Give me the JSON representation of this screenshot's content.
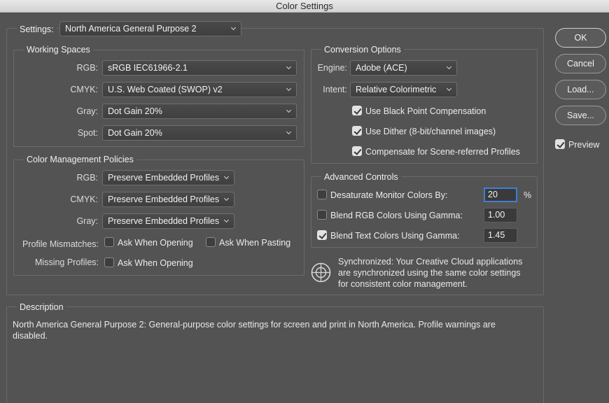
{
  "window": {
    "title": "Color Settings"
  },
  "settings": {
    "label": "Settings:",
    "value": "North America General Purpose 2"
  },
  "working_spaces": {
    "title": "Working Spaces",
    "rgb_label": "RGB:",
    "rgb_value": "sRGB IEC61966-2.1",
    "cmyk_label": "CMYK:",
    "cmyk_value": "U.S. Web Coated (SWOP) v2",
    "gray_label": "Gray:",
    "gray_value": "Dot Gain 20%",
    "spot_label": "Spot:",
    "spot_value": "Dot Gain 20%"
  },
  "policies": {
    "title": "Color Management Policies",
    "rgb_label": "RGB:",
    "rgb_value": "Preserve Embedded Profiles",
    "cmyk_label": "CMYK:",
    "cmyk_value": "Preserve Embedded Profiles",
    "gray_label": "Gray:",
    "gray_value": "Preserve Embedded Profiles",
    "mismatch_label": "Profile Mismatches:",
    "mismatch_open": {
      "label": "Ask When Opening",
      "checked": false
    },
    "mismatch_paste": {
      "label": "Ask When Pasting",
      "checked": false
    },
    "missing_label": "Missing Profiles:",
    "missing_open": {
      "label": "Ask When Opening",
      "checked": false
    }
  },
  "conversion": {
    "title": "Conversion Options",
    "engine_label": "Engine:",
    "engine_value": "Adobe (ACE)",
    "intent_label": "Intent:",
    "intent_value": "Relative Colorimetric",
    "black_point": {
      "label": "Use Black Point Compensation",
      "checked": true
    },
    "dither": {
      "label": "Use Dither (8-bit/channel images)",
      "checked": true
    },
    "scene": {
      "label": "Compensate for Scene-referred Profiles",
      "checked": true
    }
  },
  "advanced": {
    "title": "Advanced Controls",
    "desaturate": {
      "label": "Desaturate Monitor Colors By:",
      "checked": false,
      "value": "20",
      "unit": "%"
    },
    "blend_rgb": {
      "label": "Blend RGB Colors Using Gamma:",
      "checked": false,
      "value": "1.00"
    },
    "blend_text": {
      "label": "Blend Text Colors Using Gamma:",
      "checked": true,
      "value": "1.45"
    }
  },
  "sync": {
    "icon": "sync-target-icon",
    "line1": "Synchronized: Your Creative Cloud applications",
    "line2": "are synchronized using the same color settings",
    "line3": "for consistent color management."
  },
  "description": {
    "title": "Description",
    "line1": "North America General Purpose 2:  General-purpose color settings for screen and print in North America. Profile warnings are",
    "line2": "disabled."
  },
  "buttons": {
    "ok": "OK",
    "cancel": "Cancel",
    "load": "Load...",
    "save": "Save..."
  },
  "preview": {
    "label": "Preview",
    "checked": true
  },
  "colors": {
    "background": "#535353",
    "focus": "#3f7fd4"
  }
}
